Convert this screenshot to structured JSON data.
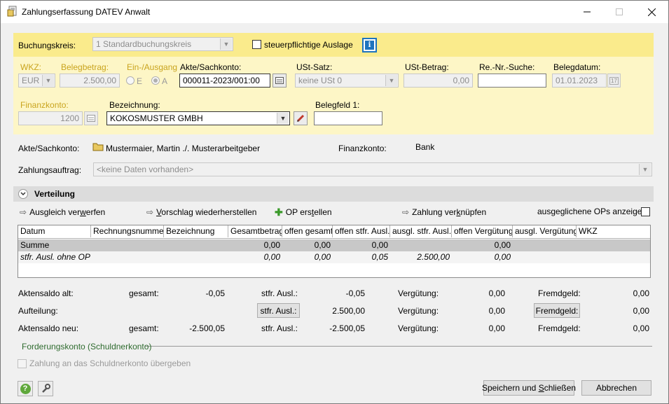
{
  "window": {
    "title": "Zahlungserfassung DATEV Anwalt"
  },
  "top": {
    "buchungskreis_label": "Buchungskreis:",
    "buchungskreis_value": "1  Standardbuchungskreis",
    "steuer_label": "steuerpflichtige Auslage",
    "info_icon": "i"
  },
  "row1": {
    "wkz_label": "WKZ:",
    "wkz_value": "EUR",
    "belegbetrag_label": "Belegbetrag:",
    "belegbetrag_value": "2.500,00",
    "einaus_label": "Ein-/Ausgang",
    "radio_e": "E",
    "radio_a": "A",
    "akte_label": "Akte/Sachkonto:",
    "akte_value": "000011-2023/001:00",
    "ustsatz_label": "USt-Satz:",
    "ustsatz_value": "keine USt  0",
    "ustbetrag_label": "USt-Betrag:",
    "ustbetrag_value": "0,00",
    "resuche_label": "Re.-Nr.-Suche:",
    "resuche_value": "",
    "belegdatum_label": "Belegdatum:",
    "belegdatum_value": "01.01.2023",
    "calendar_icon": "17"
  },
  "row2": {
    "finanzkonto_label": "Finanzkonto:",
    "finanzkonto_value": "1200",
    "bezeichnung_label": "Bezeichnung:",
    "bezeichnung_value": "KOKOSMUSTER GMBH",
    "belegfeld_label": "Belegfeld 1:",
    "belegfeld_value": ""
  },
  "info": {
    "akte_label": "Akte/Sachkonto:",
    "akte_value": "Mustermaier, Martin ./. Musterarbeitgeber",
    "finanzkonto_label": "Finanzkonto:",
    "finanzkonto_value": "Bank",
    "zahlungsauftrag_label": "Zahlungsauftrag:",
    "zahlungsauftrag_value": "<keine Daten vorhanden>"
  },
  "verteilung": {
    "title": "Verteilung",
    "collapse_icon": "⌄",
    "actions": {
      "ausgleich_pre": "Ausgleich ver",
      "ausgleich_u": "w",
      "ausgleich_post": "erfen",
      "vorschlag_u": "V",
      "vorschlag_post": "orschlag wiederherstellen",
      "op_pre": "OP ers",
      "op_u": "t",
      "op_post": "ellen",
      "zahlung_pre": "Zahlung ver",
      "zahlung_u": "k",
      "zahlung_post": "nüpfen",
      "ausgeglichene": "ausgeglichene OPs anzeigen"
    },
    "columns": [
      "Datum",
      "Rechnungsnummer",
      "Bezeichnung",
      "Gesamtbetrag",
      "offen gesamt",
      "offen stfr. Ausl.",
      "ausgl. stfr. Ausl.",
      "offen Vergütung",
      "ausgl. Vergütung",
      "WKZ"
    ],
    "rows": [
      [
        "Summe",
        "",
        "",
        "0,00",
        "0,00",
        "0,00",
        "",
        "0,00",
        "",
        ""
      ],
      [
        "stfr. Ausl. ohne OP",
        "",
        "",
        "0,00",
        "0,00",
        "0,05",
        "2.500,00",
        "0,00",
        "",
        ""
      ]
    ]
  },
  "summary": {
    "alt_label": "Aktensaldo alt:",
    "gesamt_label": "gesamt:",
    "alt_gesamt": "-0,05",
    "stfr_label": "stfr. Ausl.:",
    "alt_stfr": "-0,05",
    "verg_label": "Vergütung:",
    "alt_verg": "0,00",
    "fremd_label": "Fremdgeld:",
    "alt_fremd": "0,00",
    "auf_label": "Aufteilung:",
    "auf_stfr_btn": "stfr. Ausl.:",
    "auf_stfr": "2.500,00",
    "auf_verg": "0,00",
    "auf_fremd_btn": "Fremdgeld:",
    "auf_fremd": "0,00",
    "neu_label": "Aktensaldo neu:",
    "neu_gesamt": "-2.500,05",
    "neu_stfr": "-2.500,05",
    "neu_verg": "0,00",
    "neu_fremd": "0,00"
  },
  "forderung": {
    "title": "Forderungskonto (Schuldnerkonto)",
    "checkbox_label": "Zahlung an das Schuldnerkonto übergeben"
  },
  "footer": {
    "save_pre": "Speichern und ",
    "save_u": "S",
    "save_post": "chließen",
    "cancel": "Abbrechen"
  },
  "colors": {
    "yellow": "#faeb8c",
    "lightyellow": "#fdf6c6",
    "gold": "#c9a41e",
    "green": "#2e6b2e",
    "accent": "#1e73be"
  }
}
